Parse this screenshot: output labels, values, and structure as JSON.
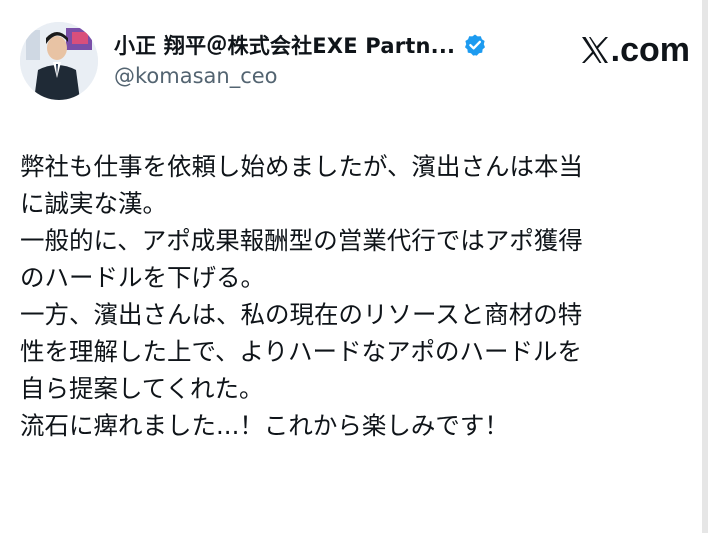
{
  "author": {
    "display_name": "小正 翔平＠株式会社EXE Partn...",
    "handle": "@komasan_ceo",
    "verified": true,
    "avatar": "profile-photo"
  },
  "brand": {
    "label": ".com",
    "logo": "x-logo-icon"
  },
  "tweet": {
    "lines": [
      "弊社も仕事を依頼し始めましたが、濱出さんは本当",
      "に誠実な漢。",
      "一般的に、アポ成果報酬型の営業代行ではアポ獲得",
      "のハードルを下げる。",
      "一方、濱出さんは、私の現在のリソースと商材の特",
      "性を理解した上で、よりハードなアポのハードルを",
      "自ら提案してくれた。",
      "流石に痺れました...！これから楽しみです！"
    ]
  },
  "colors": {
    "text": "#0f1419",
    "secondary": "#536471",
    "verified_blue": "#1d9bf0"
  }
}
